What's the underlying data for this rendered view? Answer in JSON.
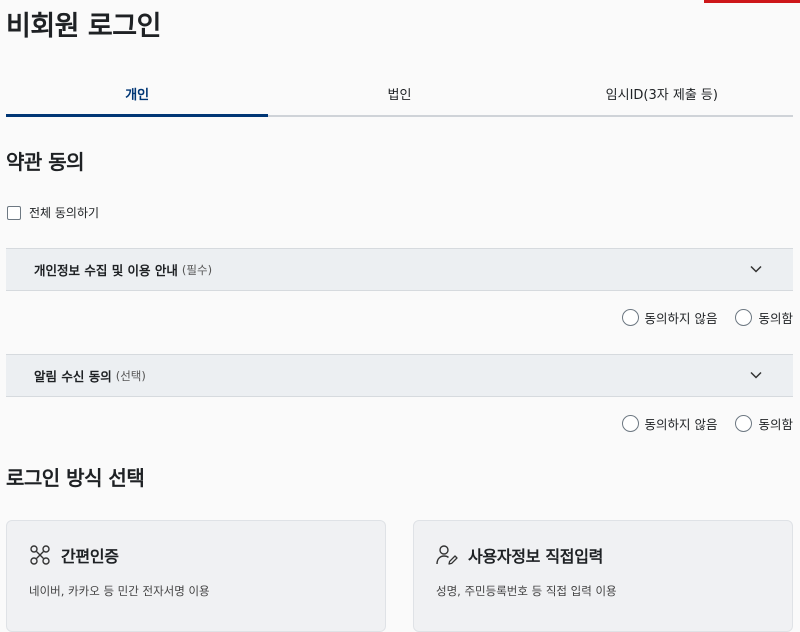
{
  "page_title": "비회원 로그인",
  "tabs": [
    {
      "label": "개인",
      "active": true
    },
    {
      "label": "법인",
      "active": false
    },
    {
      "label": "임시ID(3자 제출 등)",
      "active": false
    }
  ],
  "terms": {
    "title": "약관 동의",
    "all_agree_label": "전체 동의하기",
    "items": [
      {
        "title": "개인정보 수집 및 이용 안내",
        "tag": "(필수)",
        "option_disagree": "동의하지 않음",
        "option_agree": "동의함"
      },
      {
        "title": "알림 수신 동의",
        "tag": "(선택)",
        "option_disagree": "동의하지 않음",
        "option_agree": "동의함"
      }
    ]
  },
  "login_method": {
    "title": "로그인 방식 선택",
    "cards": [
      {
        "title": "간편인증",
        "desc": "네이버, 카카오 등 민간 전자서명 이용",
        "icon": "simple-auth-icon"
      },
      {
        "title": "사용자정보 직접입력",
        "desc": "성명, 주민등록번호 등 직접 입력 이용",
        "icon": "user-edit-icon"
      }
    ]
  },
  "colors": {
    "accent": "#003675",
    "top_bar": "#cd1719",
    "accordion_bg": "#eceff2"
  }
}
